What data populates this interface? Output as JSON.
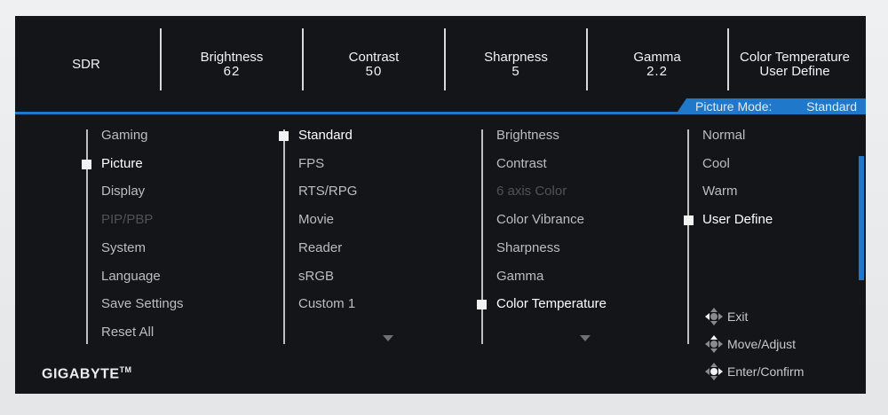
{
  "top_stats": [
    {
      "label": "SDR",
      "value": ""
    },
    {
      "label": "Brightness",
      "value": "62"
    },
    {
      "label": "Contrast",
      "value": "50"
    },
    {
      "label": "Sharpness",
      "value": "5"
    },
    {
      "label": "Gamma",
      "value": "2.2"
    },
    {
      "label": "Color Temperature",
      "value": "User Define"
    }
  ],
  "picture_mode": {
    "label": "Picture Mode:",
    "value": "Standard"
  },
  "main_menu": [
    {
      "label": "Gaming",
      "state": "normal"
    },
    {
      "label": "Picture",
      "state": "selected"
    },
    {
      "label": "Display",
      "state": "normal"
    },
    {
      "label": "PIP/PBP",
      "state": "disabled"
    },
    {
      "label": "System",
      "state": "normal"
    },
    {
      "label": "Language",
      "state": "normal"
    },
    {
      "label": "Save Settings",
      "state": "normal"
    },
    {
      "label": "Reset All",
      "state": "normal"
    }
  ],
  "mode_menu": [
    {
      "label": "Standard",
      "state": "selected"
    },
    {
      "label": "FPS",
      "state": "normal"
    },
    {
      "label": "RTS/RPG",
      "state": "normal"
    },
    {
      "label": "Movie",
      "state": "normal"
    },
    {
      "label": "Reader",
      "state": "normal"
    },
    {
      "label": "sRGB",
      "state": "normal"
    },
    {
      "label": "Custom 1",
      "state": "normal"
    }
  ],
  "setting_menu": [
    {
      "label": "Brightness",
      "state": "normal"
    },
    {
      "label": "Contrast",
      "state": "normal"
    },
    {
      "label": "6 axis Color",
      "state": "disabled"
    },
    {
      "label": "Color Vibrance",
      "state": "normal"
    },
    {
      "label": "Sharpness",
      "state": "normal"
    },
    {
      "label": "Gamma",
      "state": "normal"
    },
    {
      "label": "Color Temperature",
      "state": "selected"
    }
  ],
  "temperature_menu": [
    {
      "label": "Normal",
      "state": "normal"
    },
    {
      "label": "Cool",
      "state": "normal"
    },
    {
      "label": "Warm",
      "state": "normal"
    },
    {
      "label": "User Define",
      "state": "selected"
    }
  ],
  "help": [
    {
      "icon": "joystick-icon",
      "label": "Exit"
    },
    {
      "icon": "joystick-icon",
      "label": "Move/Adjust"
    },
    {
      "icon": "joystick-icon",
      "label": "Enter/Confirm"
    }
  ],
  "brand": {
    "name": "GIGABYTE",
    "mark": "TM"
  },
  "colors": {
    "accent": "#1f78c9",
    "background": "#141519",
    "text_active": "#ffffff",
    "text_normal": "#bdbdbd",
    "text_disabled": "#505257"
  }
}
